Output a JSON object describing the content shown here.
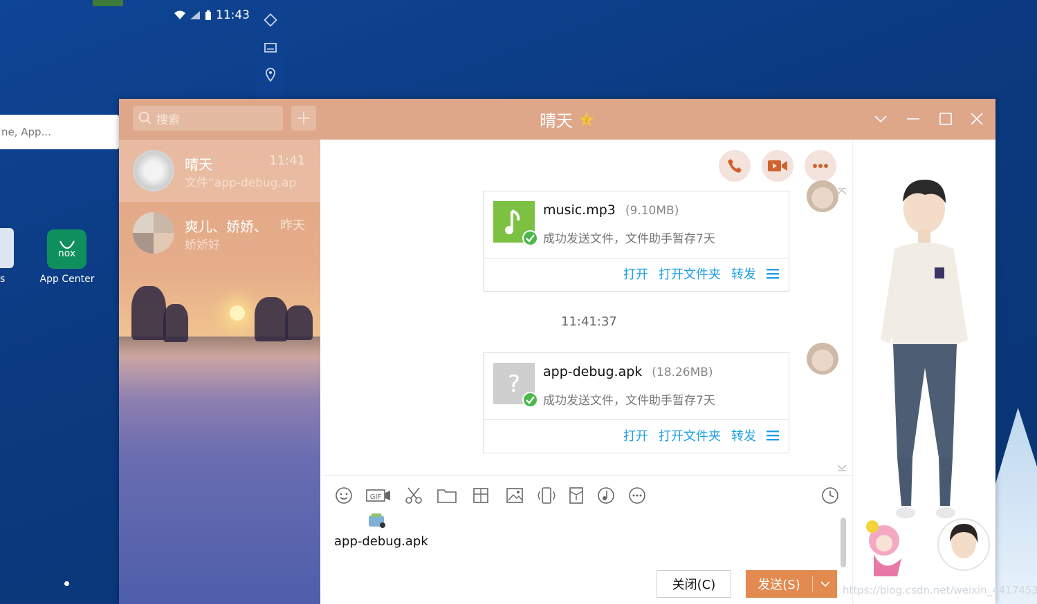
{
  "desktop": {
    "status_time": "11:43",
    "search_placeholder": "ne, App...",
    "left_icon_label": "s",
    "app_center_label": "App Center",
    "app_center_icon_text": "nox",
    "watermark": "https://blog.csdn.net/weixin_44174536"
  },
  "window": {
    "title": "晴天",
    "search_placeholder": "搜索"
  },
  "contacts": [
    {
      "name": "晴天",
      "time": "11:41",
      "last_message": "文件“app-debug.ap",
      "active": true
    },
    {
      "name": "爽儿、娇娇、",
      "time": "昨天",
      "last_message": "娇娇好",
      "active": false
    }
  ],
  "messages": [
    {
      "file_name": "music.mp3",
      "file_size": "(9.10MB)",
      "status": "成功发送文件，文件助手暂存7天",
      "icon": "music-file-icon"
    },
    {
      "file_name": "app-debug.apk",
      "file_size": "(18.26MB)",
      "status": "成功发送文件，文件助手暂存7天",
      "icon": "unknown-file-icon"
    }
  ],
  "timestamp": "11:41:37",
  "file_actions": {
    "open": "打开",
    "open_folder": "打开文件夹",
    "forward": "转发"
  },
  "composer": {
    "attachment_name": "app-debug.apk",
    "close_label": "关闭(C)",
    "send_label": "发送(S)"
  },
  "colors": {
    "titlebar": "#dea78a",
    "link": "#1c9fe6",
    "send_button": "#e28a4f",
    "success": "#4cb84c"
  }
}
